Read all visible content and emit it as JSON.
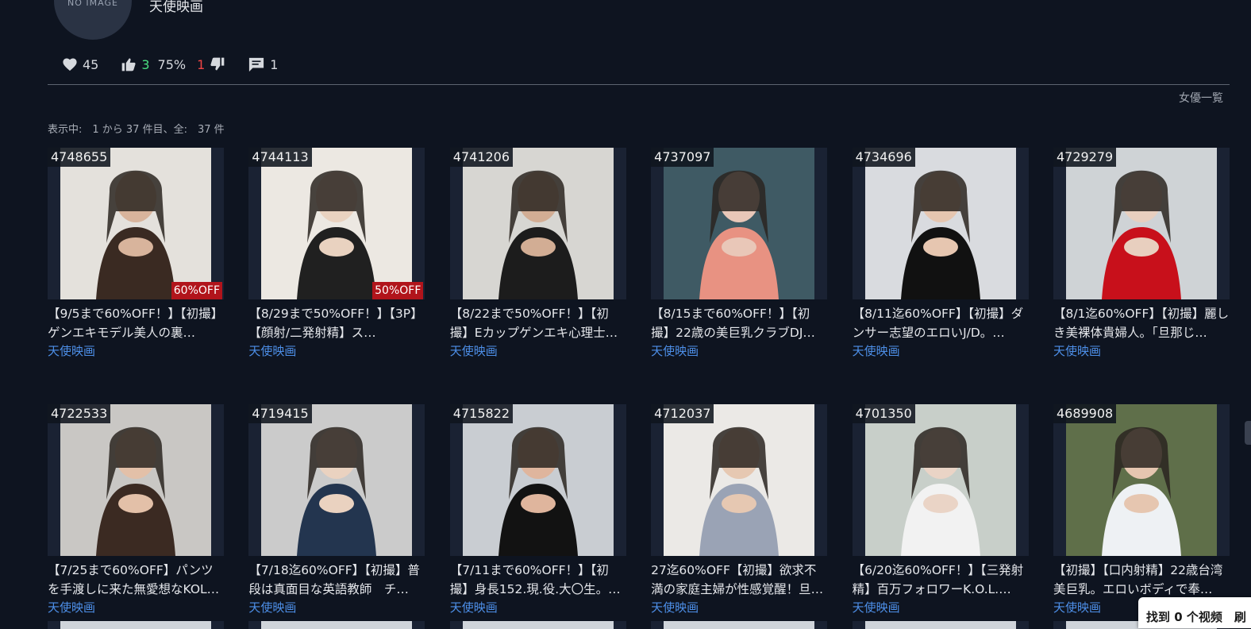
{
  "profile": {
    "avatar_text": "NO IMAGE",
    "name": "天使映画"
  },
  "stats": {
    "favorites": "45",
    "likes": "3",
    "like_rate": "75%",
    "dislikes": "1",
    "comments": "1"
  },
  "nav": {
    "actress_list": "女優一覧"
  },
  "results": {
    "summary": "表示中:　1 から 37 件目、全:　37 件"
  },
  "videos": [
    {
      "id": "4748655",
      "title": "【9/5まで60%OFF！】【初撮】ゲンエキモデル美人の裏…",
      "studio": "天使映画",
      "badge": "60%OFF"
    },
    {
      "id": "4744113",
      "title": "【8/29まで50%OFF！】【3P】【顔射/二発射精】ス…",
      "studio": "天使映画",
      "badge": "50%OFF"
    },
    {
      "id": "4741206",
      "title": "【8/22まで50%OFF！】【初撮】Eカップゲンエキ心理士…",
      "studio": "天使映画",
      "badge": ""
    },
    {
      "id": "4737097",
      "title": "【8/15まで60%OFF！】【初撮】22歳の美巨乳クラブDJ…",
      "studio": "天使映画",
      "badge": ""
    },
    {
      "id": "4734696",
      "title": "【8/11迄60%OFF】【初撮】ダンサー志望のエロいJ/D。…",
      "studio": "天使映画",
      "badge": ""
    },
    {
      "id": "4729279",
      "title": "【8/1迄60%OFF】【初撮】麗しき美裸体貴婦人。「旦那じ…",
      "studio": "天使映画",
      "badge": ""
    },
    {
      "id": "4722533",
      "title": "【7/25まで60%OFF】パンツを手渡しに来た無愛想なKOL…",
      "studio": "天使映画",
      "badge": ""
    },
    {
      "id": "4719415",
      "title": "【7/18迄60%OFF】【初撮】普段は真面目な英語教師　チ…",
      "studio": "天使映画",
      "badge": ""
    },
    {
      "id": "4715822",
      "title": "【7/11まで60%OFF！】【初撮】身長152.現.役.大〇生。…",
      "studio": "天使映画",
      "badge": ""
    },
    {
      "id": "4712037",
      "title": "27迄60%OFF【初撮】欲求不満の家庭主婦が性感覚醒！旦…",
      "studio": "天使映画",
      "badge": ""
    },
    {
      "id": "4701350",
      "title": "【6/20迄60%OFF！】【三発射精】百万フォロワーK.O.L.…",
      "studio": "天使映画",
      "badge": ""
    },
    {
      "id": "4689908",
      "title": "【初撮】【口内射精】22歳台湾美巨乳。エロいボディで奉…",
      "studio": "天使映画",
      "badge": ""
    }
  ],
  "thumb_palettes": [
    [
      "#e4e1dc",
      "#3a2a22",
      "#d8b49c"
    ],
    [
      "#ece8e2",
      "#202020",
      "#e9d2c0"
    ],
    [
      "#d7d6d2",
      "#1c1c1c",
      "#d2ad94"
    ],
    [
      "#3f5a64",
      "#e89282",
      "#e9c7b8"
    ],
    [
      "#d9dbdf",
      "#111111",
      "#e6c6b0"
    ],
    [
      "#cfd3d6",
      "#c8101b",
      "#e8cfbf"
    ],
    [
      "#c9c7c4",
      "#3b2a22",
      "#e3c0a8"
    ],
    [
      "#cbcbcb",
      "#23354f",
      "#ead2c0"
    ],
    [
      "#c9cdd2",
      "#121212",
      "#dfb59d"
    ],
    [
      "#ebe9e6",
      "#9aa3b5",
      "#e6c8b2"
    ],
    [
      "#c8cfc9",
      "#f2f2f2",
      "#ead4c6"
    ],
    [
      "#5f6f4a",
      "#eef1f4",
      "#e6c6b0"
    ]
  ],
  "find_bar": {
    "text": "找到 0 个视频　刷"
  }
}
